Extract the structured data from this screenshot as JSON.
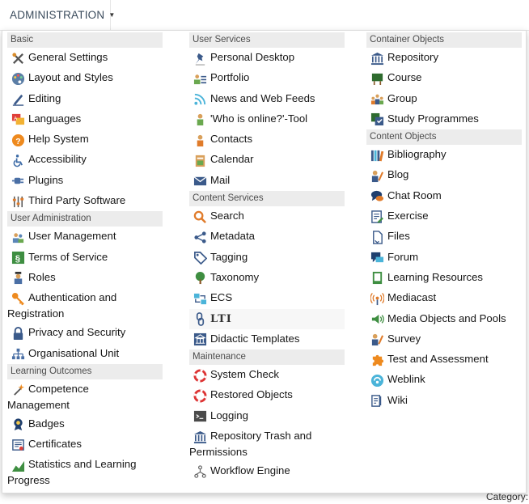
{
  "trigger": {
    "label": "ADMINISTRATION"
  },
  "background": {
    "category_label": "Category:"
  },
  "columns": [
    {
      "sections": [
        {
          "header": "Basic",
          "items": [
            {
              "label": "General Settings",
              "icon": "tools-icon"
            },
            {
              "label": "Layout and Styles",
              "icon": "palette-icon"
            },
            {
              "label": "Editing",
              "icon": "pen-icon"
            },
            {
              "label": "Languages",
              "icon": "languages-icon"
            },
            {
              "label": "Help System",
              "icon": "help-icon"
            },
            {
              "label": "Accessibility",
              "icon": "wheelchair-icon"
            },
            {
              "label": "Plugins",
              "icon": "plug-icon"
            },
            {
              "label": "Third Party Software",
              "icon": "sliders-icon"
            }
          ]
        },
        {
          "header": "User Administration",
          "items": [
            {
              "label": "User Management",
              "icon": "users-icon"
            },
            {
              "label": "Terms of Service",
              "icon": "paragraph-icon"
            },
            {
              "label": "Roles",
              "icon": "role-icon"
            },
            {
              "label": "Authentication and",
              "label2": "Registration",
              "icon": "key-icon"
            },
            {
              "label": "Privacy and Security",
              "icon": "lock-icon"
            },
            {
              "label": "Organisational Unit",
              "icon": "org-unit-icon"
            }
          ]
        },
        {
          "header": "Learning Outcomes",
          "items": [
            {
              "label": "Competence",
              "label2": "Management",
              "icon": "wand-icon"
            },
            {
              "label": "Badges",
              "icon": "badge-icon"
            },
            {
              "label": "Certificates",
              "icon": "certificate-icon"
            },
            {
              "label": "Statistics and Learning",
              "label2": "Progress",
              "icon": "statistics-icon"
            }
          ]
        }
      ]
    },
    {
      "sections": [
        {
          "header": "User Services",
          "items": [
            {
              "label": "Personal Desktop",
              "icon": "pin-icon"
            },
            {
              "label": "Portfolio",
              "icon": "portfolio-icon"
            },
            {
              "label": "News and Web Feeds",
              "icon": "rss-icon"
            },
            {
              "label": "'Who is online?'-Tool",
              "icon": "person-icon"
            },
            {
              "label": "Contacts",
              "icon": "contacts-icon"
            },
            {
              "label": "Calendar",
              "icon": "calendar-icon"
            },
            {
              "label": "Mail",
              "icon": "mail-icon"
            }
          ]
        },
        {
          "header": "Content Services",
          "items": [
            {
              "label": "Search",
              "icon": "search-icon"
            },
            {
              "label": "Metadata",
              "icon": "share-icon"
            },
            {
              "label": "Tagging",
              "icon": "tag-icon"
            },
            {
              "label": "Taxonomy",
              "icon": "tree-icon"
            },
            {
              "label": "ECS",
              "icon": "ecs-icon"
            },
            {
              "label": "LTI",
              "icon": "link-icon"
            },
            {
              "label": "Didactic Templates",
              "icon": "template-icon"
            }
          ]
        },
        {
          "header": "Maintenance",
          "items": [
            {
              "label": "System Check",
              "icon": "lifebuoy-icon"
            },
            {
              "label": "Restored Objects",
              "icon": "lifebuoy-icon"
            },
            {
              "label": "Logging",
              "icon": "terminal-icon"
            },
            {
              "label": "Repository Trash and",
              "label2": "Permissions",
              "icon": "repository-icon"
            },
            {
              "label": "Workflow Engine",
              "icon": "workflow-icon"
            }
          ]
        }
      ]
    },
    {
      "sections": [
        {
          "header": "Container Objects",
          "items": [
            {
              "label": "Repository",
              "icon": "repository-icon"
            },
            {
              "label": "Course",
              "icon": "course-icon"
            },
            {
              "label": "Group",
              "icon": "group-icon"
            },
            {
              "label": "Study Programmes",
              "icon": "study-programme-icon"
            }
          ]
        },
        {
          "header": "Content Objects",
          "items": [
            {
              "label": "Bibliography",
              "icon": "bibliography-icon"
            },
            {
              "label": "Blog",
              "icon": "blog-icon"
            },
            {
              "label": "Chat Room",
              "icon": "chat-icon"
            },
            {
              "label": "Exercise",
              "icon": "exercise-icon"
            },
            {
              "label": "Files",
              "icon": "file-icon"
            },
            {
              "label": "Forum",
              "icon": "forum-icon"
            },
            {
              "label": "Learning Resources",
              "icon": "learning-resources-icon"
            },
            {
              "label": "Mediacast",
              "icon": "mediacast-icon"
            },
            {
              "label": "Media Objects and Pools",
              "icon": "speaker-icon"
            },
            {
              "label": "Survey",
              "icon": "survey-icon"
            },
            {
              "label": "Test and Assessment",
              "icon": "puzzle-icon"
            },
            {
              "label": "Weblink",
              "icon": "weblink-icon"
            },
            {
              "label": "Wiki",
              "icon": "wiki-icon"
            }
          ]
        }
      ]
    }
  ]
}
